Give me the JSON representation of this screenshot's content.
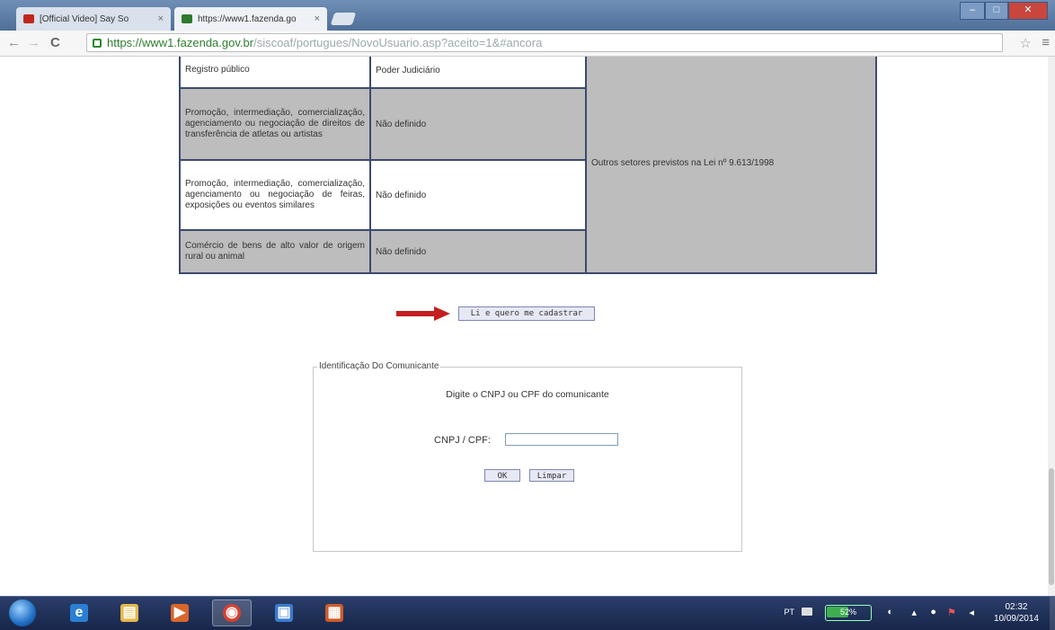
{
  "browser": {
    "tabs": [
      {
        "title": "[Official Video] Say So",
        "active": false,
        "favicon_color": "#c0261c"
      },
      {
        "title": "https://www1.fazenda.go",
        "active": true,
        "favicon_color": "#2c7a2c"
      }
    ],
    "close_glyph": "×",
    "url_host": "https://www1.fazenda.gov.br",
    "url_path": "/siscoaf/portugues/NovoUsuario.asp?aceito=1&#ancora",
    "back_glyph": "←",
    "forward_glyph": "→",
    "reload_glyph": "C",
    "star_glyph": "☆",
    "menu_glyph": "≡"
  },
  "table": {
    "rows": [
      {
        "activity": "Registro público",
        "regulator": "Poder Judiciário",
        "shaded": false
      },
      {
        "activity": "Promoção, intermediação, comercialização, agenciamento ou negociação de direitos de transferência de atletas ou artistas",
        "regulator": "Não definido",
        "shaded": true
      },
      {
        "activity": "Promoção, intermediação, comercialização, agenciamento ou negociação de feiras, exposições ou eventos similares",
        "regulator": "Não definido",
        "shaded": false
      },
      {
        "activity": "Comércio de bens de alto valor de origem rural ou animal",
        "regulator": "Não definido",
        "shaded": true
      }
    ],
    "merged_sector": "Outros setores previstos na Lei nº 9.613/1998"
  },
  "cadastrar_button": "Li e quero me cadastrar",
  "form": {
    "legend": "Identificação Do Comunicante",
    "hint": "Digite o CNPJ ou CPF do comunicante",
    "cnpj_label": "CNPJ / CPF:",
    "cnpj_value": "",
    "ok_label": "OK",
    "limpar_label": "Limpar"
  },
  "taskbar": {
    "apps": [
      {
        "name": "internet-explorer",
        "glyph": "e",
        "color": "#2a7fd4"
      },
      {
        "name": "file-explorer",
        "glyph": "▤",
        "color": "#e6b84a"
      },
      {
        "name": "media-player",
        "glyph": "▶",
        "color": "#d8662a"
      },
      {
        "name": "chrome",
        "glyph": "◉",
        "color": "#d8412f"
      },
      {
        "name": "remote-desktop",
        "glyph": "▣",
        "color": "#3b7bd0"
      },
      {
        "name": "powerpoint",
        "glyph": "▦",
        "color": "#d05a2a"
      }
    ],
    "language": "PT",
    "battery_percent": 52,
    "battery_label": "52%",
    "time": "02:32",
    "date": "10/09/2014"
  },
  "colors": {
    "shaded_cell": "#bdbdbd",
    "table_border": "#3d4a6e",
    "arrow": "#c41e1e",
    "url_host": "#2e7d2e"
  }
}
